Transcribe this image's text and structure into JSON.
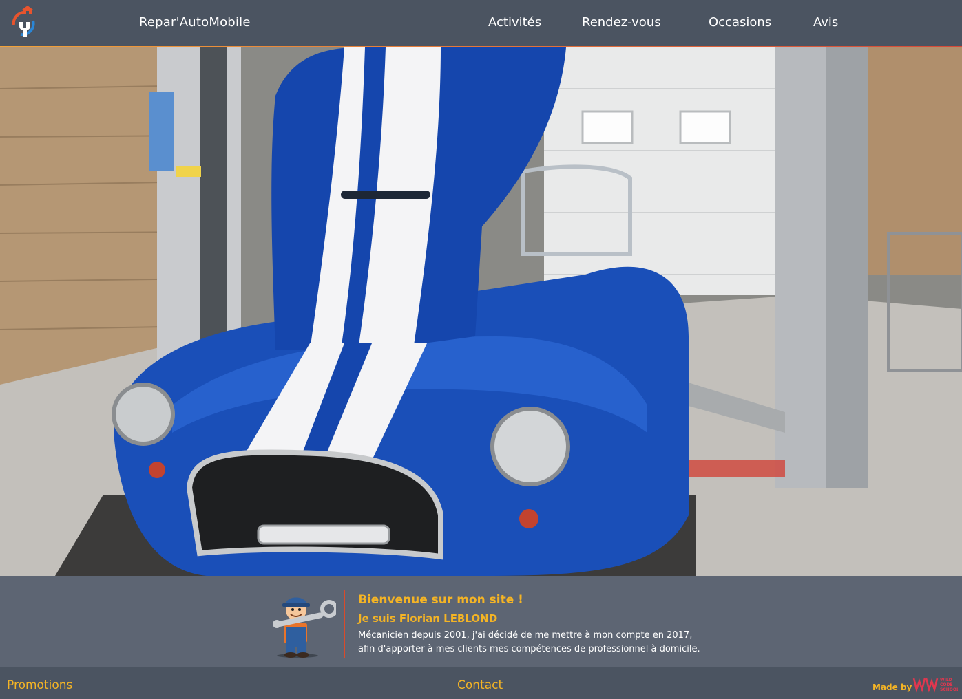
{
  "header": {
    "brand": "Repar'AutoMobile",
    "logo_icon": "wrench-house-logo-icon",
    "nav": [
      {
        "label": "Activités"
      },
      {
        "label": "Rendez-vous"
      },
      {
        "label": "Occasions"
      },
      {
        "label": "Avis"
      }
    ]
  },
  "hero": {
    "image": "blue-cobra-car-in-garage-photo"
  },
  "intro": {
    "mascot_icon": "mechanic-mascot-icon",
    "title": "Bienvenue sur mon site !",
    "subtitle": "Je suis Florian LEBLOND",
    "text_line1": "Mécanicien depuis 2001, j'ai décidé de me mettre à mon compte en 2017,",
    "text_line2": "afin d'apporter à mes clients mes compétences de professionnel à domicile."
  },
  "footer": {
    "promotions": "Promotions",
    "contact": "Contact",
    "made_by": "Made by",
    "school_logo_text": "WILD CODE SCHOOL"
  },
  "colors": {
    "header_bg": "#4b5461",
    "band_bg": "#5d6573",
    "accent": "#f4b425",
    "divider": "#d94b2b"
  }
}
